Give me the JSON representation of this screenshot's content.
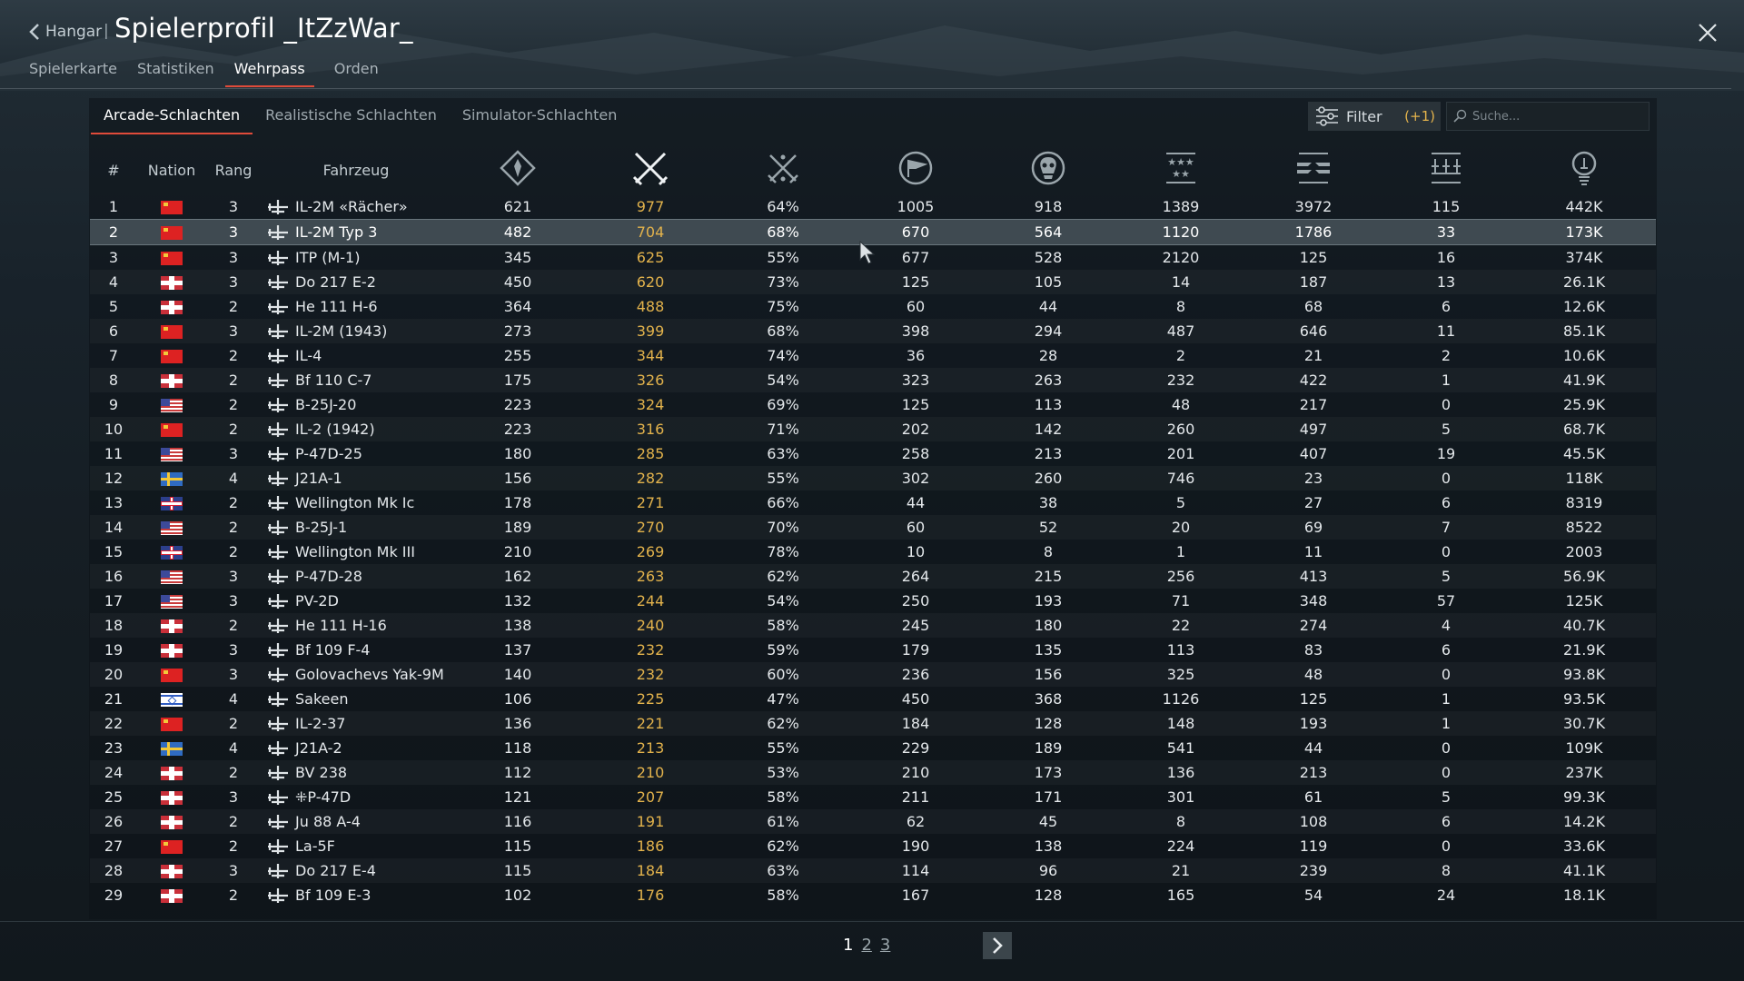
{
  "header": {
    "back_label": "Hangar",
    "separator": "|",
    "title": "Spielerprofil _ItZzWar_"
  },
  "main_tabs": [
    {
      "label": "Spielerkarte",
      "active": false
    },
    {
      "label": "Statistiken",
      "active": false
    },
    {
      "label": "Wehrpass",
      "active": true
    },
    {
      "label": "Orden",
      "active": false
    }
  ],
  "sub_tabs": [
    {
      "label": "Arcade-Schlachten",
      "active": true
    },
    {
      "label": "Realistische Schlachten",
      "active": false
    },
    {
      "label": "Simulator-Schlachten",
      "active": false
    }
  ],
  "filter": {
    "label": "Filter",
    "count": "(+1)"
  },
  "search": {
    "placeholder": "Suche..."
  },
  "colors": {
    "accent": "#e04b3a",
    "kills": "#e3b34c",
    "selected_row": "#3f4a51"
  },
  "table": {
    "headers": {
      "index": "#",
      "nation": "Nation",
      "rank": "Rang",
      "vehicle": "Fahrzeug"
    },
    "icon_columns": [
      "battles-icon",
      "crossed-swords-icon",
      "crossed-swords-stars-icon",
      "flag-icon",
      "skull-icon",
      "rank-stars-icon",
      "wings-icon",
      "ground-units-icon",
      "lightbulb-icon"
    ],
    "selected_index": 2,
    "rows": [
      {
        "n": "1",
        "nation": "ussr",
        "rank": "3",
        "vehicle": "IL-2M «Rächer»",
        "c1": "621",
        "c2": "977",
        "c3": "64%",
        "c4": "1005",
        "c5": "918",
        "c6": "1389",
        "c7": "3972",
        "c8": "115",
        "c9": "442K"
      },
      {
        "n": "2",
        "nation": "ussr",
        "rank": "3",
        "vehicle": "IL-2M Typ 3",
        "c1": "482",
        "c2": "704",
        "c3": "68%",
        "c4": "670",
        "c5": "564",
        "c6": "1120",
        "c7": "1786",
        "c8": "33",
        "c9": "173K"
      },
      {
        "n": "3",
        "nation": "ussr",
        "rank": "3",
        "vehicle": "ITP (M-1)",
        "c1": "345",
        "c2": "625",
        "c3": "55%",
        "c4": "677",
        "c5": "528",
        "c6": "2120",
        "c7": "125",
        "c8": "16",
        "c9": "374K"
      },
      {
        "n": "4",
        "nation": "germany",
        "rank": "3",
        "vehicle": "Do 217 E-2",
        "c1": "450",
        "c2": "620",
        "c3": "73%",
        "c4": "125",
        "c5": "105",
        "c6": "14",
        "c7": "187",
        "c8": "13",
        "c9": "26.1K"
      },
      {
        "n": "5",
        "nation": "germany",
        "rank": "2",
        "vehicle": "He 111 H-6",
        "c1": "364",
        "c2": "488",
        "c3": "75%",
        "c4": "60",
        "c5": "44",
        "c6": "8",
        "c7": "68",
        "c8": "6",
        "c9": "12.6K"
      },
      {
        "n": "6",
        "nation": "ussr",
        "rank": "3",
        "vehicle": "IL-2M (1943)",
        "c1": "273",
        "c2": "399",
        "c3": "68%",
        "c4": "398",
        "c5": "294",
        "c6": "487",
        "c7": "646",
        "c8": "11",
        "c9": "85.1K"
      },
      {
        "n": "7",
        "nation": "ussr",
        "rank": "2",
        "vehicle": "IL-4",
        "c1": "255",
        "c2": "344",
        "c3": "74%",
        "c4": "36",
        "c5": "28",
        "c6": "2",
        "c7": "21",
        "c8": "2",
        "c9": "10.6K"
      },
      {
        "n": "8",
        "nation": "germany",
        "rank": "2",
        "vehicle": "Bf 110 C-7",
        "c1": "175",
        "c2": "326",
        "c3": "54%",
        "c4": "323",
        "c5": "263",
        "c6": "232",
        "c7": "422",
        "c8": "1",
        "c9": "41.9K"
      },
      {
        "n": "9",
        "nation": "usa",
        "rank": "2",
        "vehicle": "B-25J-20",
        "c1": "223",
        "c2": "324",
        "c3": "69%",
        "c4": "125",
        "c5": "113",
        "c6": "48",
        "c7": "217",
        "c8": "0",
        "c9": "25.9K"
      },
      {
        "n": "10",
        "nation": "ussr",
        "rank": "2",
        "vehicle": "IL-2 (1942)",
        "c1": "223",
        "c2": "316",
        "c3": "71%",
        "c4": "202",
        "c5": "142",
        "c6": "260",
        "c7": "497",
        "c8": "5",
        "c9": "68.7K"
      },
      {
        "n": "11",
        "nation": "usa",
        "rank": "3",
        "vehicle": "P-47D-25",
        "c1": "180",
        "c2": "285",
        "c3": "63%",
        "c4": "258",
        "c5": "213",
        "c6": "201",
        "c7": "407",
        "c8": "19",
        "c9": "45.5K"
      },
      {
        "n": "12",
        "nation": "sweden",
        "rank": "4",
        "vehicle": "J21A-1",
        "c1": "156",
        "c2": "282",
        "c3": "55%",
        "c4": "302",
        "c5": "260",
        "c6": "746",
        "c7": "23",
        "c8": "0",
        "c9": "118K"
      },
      {
        "n": "13",
        "nation": "uk",
        "rank": "2",
        "vehicle": "Wellington Mk Ic",
        "c1": "178",
        "c2": "271",
        "c3": "66%",
        "c4": "44",
        "c5": "38",
        "c6": "5",
        "c7": "27",
        "c8": "6",
        "c9": "8319"
      },
      {
        "n": "14",
        "nation": "usa",
        "rank": "2",
        "vehicle": "B-25J-1",
        "c1": "189",
        "c2": "270",
        "c3": "70%",
        "c4": "60",
        "c5": "52",
        "c6": "20",
        "c7": "69",
        "c8": "7",
        "c9": "8522"
      },
      {
        "n": "15",
        "nation": "uk",
        "rank": "2",
        "vehicle": "Wellington Mk III",
        "c1": "210",
        "c2": "269",
        "c3": "78%",
        "c4": "10",
        "c5": "8",
        "c6": "1",
        "c7": "11",
        "c8": "0",
        "c9": "2003"
      },
      {
        "n": "16",
        "nation": "usa",
        "rank": "3",
        "vehicle": "P-47D-28",
        "c1": "162",
        "c2": "263",
        "c3": "62%",
        "c4": "264",
        "c5": "215",
        "c6": "256",
        "c7": "413",
        "c8": "5",
        "c9": "56.9K"
      },
      {
        "n": "17",
        "nation": "usa",
        "rank": "3",
        "vehicle": "PV-2D",
        "c1": "132",
        "c2": "244",
        "c3": "54%",
        "c4": "250",
        "c5": "193",
        "c6": "71",
        "c7": "348",
        "c8": "57",
        "c9": "125K"
      },
      {
        "n": "18",
        "nation": "germany",
        "rank": "2",
        "vehicle": "He 111 H-16",
        "c1": "138",
        "c2": "240",
        "c3": "58%",
        "c4": "245",
        "c5": "180",
        "c6": "22",
        "c7": "274",
        "c8": "4",
        "c9": "40.7K"
      },
      {
        "n": "19",
        "nation": "germany",
        "rank": "3",
        "vehicle": "Bf 109 F-4",
        "c1": "137",
        "c2": "232",
        "c3": "59%",
        "c4": "179",
        "c5": "135",
        "c6": "113",
        "c7": "83",
        "c8": "6",
        "c9": "21.9K"
      },
      {
        "n": "20",
        "nation": "ussr",
        "rank": "3",
        "vehicle": "Golovachevs Yak-9M",
        "c1": "140",
        "c2": "232",
        "c3": "60%",
        "c4": "236",
        "c5": "156",
        "c6": "325",
        "c7": "48",
        "c8": "0",
        "c9": "93.8K"
      },
      {
        "n": "21",
        "nation": "israel",
        "rank": "4",
        "vehicle": "Sakeen",
        "c1": "106",
        "c2": "225",
        "c3": "47%",
        "c4": "450",
        "c5": "368",
        "c6": "1126",
        "c7": "125",
        "c8": "1",
        "c9": "93.5K"
      },
      {
        "n": "22",
        "nation": "ussr",
        "rank": "2",
        "vehicle": "IL-2-37",
        "c1": "136",
        "c2": "221",
        "c3": "62%",
        "c4": "184",
        "c5": "128",
        "c6": "148",
        "c7": "193",
        "c8": "1",
        "c9": "30.7K"
      },
      {
        "n": "23",
        "nation": "sweden",
        "rank": "4",
        "vehicle": "J21A-2",
        "c1": "118",
        "c2": "213",
        "c3": "55%",
        "c4": "229",
        "c5": "189",
        "c6": "541",
        "c7": "44",
        "c8": "0",
        "c9": "109K"
      },
      {
        "n": "24",
        "nation": "germany",
        "rank": "2",
        "vehicle": "BV 238",
        "c1": "112",
        "c2": "210",
        "c3": "53%",
        "c4": "210",
        "c5": "173",
        "c6": "136",
        "c7": "213",
        "c8": "0",
        "c9": "237K"
      },
      {
        "n": "25",
        "nation": "germany",
        "rank": "3",
        "vehicle": "⁜P-47D",
        "c1": "121",
        "c2": "207",
        "c3": "58%",
        "c4": "211",
        "c5": "171",
        "c6": "301",
        "c7": "61",
        "c8": "5",
        "c9": "99.3K"
      },
      {
        "n": "26",
        "nation": "germany",
        "rank": "2",
        "vehicle": "Ju 88 A-4",
        "c1": "116",
        "c2": "191",
        "c3": "61%",
        "c4": "62",
        "c5": "45",
        "c6": "8",
        "c7": "108",
        "c8": "6",
        "c9": "14.2K"
      },
      {
        "n": "27",
        "nation": "ussr",
        "rank": "2",
        "vehicle": "La-5F",
        "c1": "115",
        "c2": "186",
        "c3": "62%",
        "c4": "190",
        "c5": "138",
        "c6": "224",
        "c7": "119",
        "c8": "0",
        "c9": "33.6K"
      },
      {
        "n": "28",
        "nation": "germany",
        "rank": "3",
        "vehicle": "Do 217 E-4",
        "c1": "115",
        "c2": "184",
        "c3": "63%",
        "c4": "114",
        "c5": "96",
        "c6": "21",
        "c7": "239",
        "c8": "8",
        "c9": "41.1K"
      },
      {
        "n": "29",
        "nation": "germany",
        "rank": "2",
        "vehicle": "Bf 109 E-3",
        "c1": "102",
        "c2": "176",
        "c3": "58%",
        "c4": "167",
        "c5": "128",
        "c6": "165",
        "c7": "54",
        "c8": "24",
        "c9": "18.1K"
      }
    ]
  },
  "pagination": {
    "pages": [
      "1",
      "2",
      "3"
    ],
    "current": "1"
  }
}
